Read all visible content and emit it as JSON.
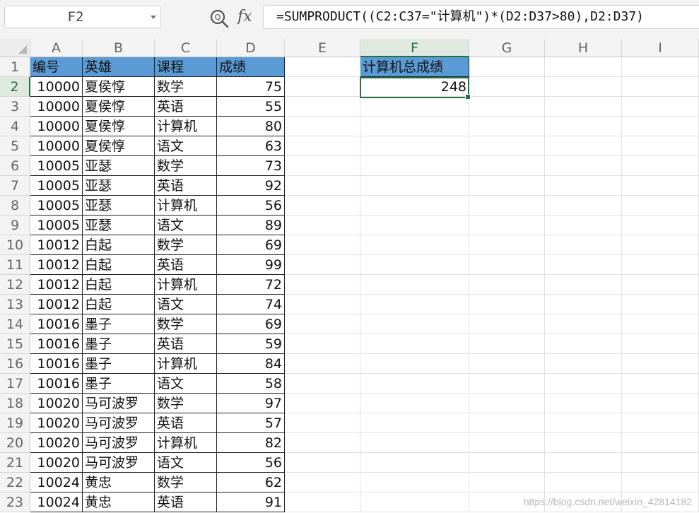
{
  "namebox": {
    "value": "F2"
  },
  "formula_bar": {
    "formula": "=SUMPRODUCT((C2:C37=\"计算机\")*(D2:D37>80),D2:D37)",
    "fx_label": "fx",
    "zoom_icon": "zoom-formula-icon"
  },
  "columns": [
    "A",
    "B",
    "C",
    "D",
    "E",
    "F",
    "G",
    "H",
    "I"
  ],
  "rows": [
    "1",
    "2",
    "3",
    "4",
    "5",
    "6",
    "7",
    "8",
    "9",
    "10",
    "11",
    "12",
    "13",
    "14",
    "15",
    "16",
    "17",
    "18",
    "19",
    "20",
    "21",
    "22",
    "23"
  ],
  "table": {
    "headers": [
      "编号",
      "英雄",
      "课程",
      "成绩"
    ],
    "rows": [
      [
        "10000",
        "夏侯惇",
        "数学",
        "75"
      ],
      [
        "10000",
        "夏侯惇",
        "英语",
        "55"
      ],
      [
        "10000",
        "夏侯惇",
        "计算机",
        "80"
      ],
      [
        "10000",
        "夏侯惇",
        "语文",
        "63"
      ],
      [
        "10005",
        "亚瑟",
        "数学",
        "73"
      ],
      [
        "10005",
        "亚瑟",
        "英语",
        "92"
      ],
      [
        "10005",
        "亚瑟",
        "计算机",
        "56"
      ],
      [
        "10005",
        "亚瑟",
        "语文",
        "89"
      ],
      [
        "10012",
        "白起",
        "数学",
        "69"
      ],
      [
        "10012",
        "白起",
        "英语",
        "99"
      ],
      [
        "10012",
        "白起",
        "计算机",
        "72"
      ],
      [
        "10012",
        "白起",
        "语文",
        "74"
      ],
      [
        "10016",
        "墨子",
        "数学",
        "69"
      ],
      [
        "10016",
        "墨子",
        "英语",
        "59"
      ],
      [
        "10016",
        "墨子",
        "计算机",
        "84"
      ],
      [
        "10016",
        "墨子",
        "语文",
        "58"
      ],
      [
        "10020",
        "马可波罗",
        "数学",
        "97"
      ],
      [
        "10020",
        "马可波罗",
        "英语",
        "57"
      ],
      [
        "10020",
        "马可波罗",
        "计算机",
        "82"
      ],
      [
        "10020",
        "马可波罗",
        "语文",
        "56"
      ],
      [
        "10024",
        "黄忠",
        "数学",
        "62"
      ],
      [
        "10024",
        "黄忠",
        "英语",
        "91"
      ]
    ]
  },
  "result": {
    "header": "计算机总成绩",
    "value": "248"
  },
  "selected": {
    "column": "F",
    "row": "2"
  },
  "colors": {
    "header_fill": "#5b9bd5",
    "selection": "#217346"
  },
  "watermark": "https://blog.csdn.net/weixin_42814182"
}
